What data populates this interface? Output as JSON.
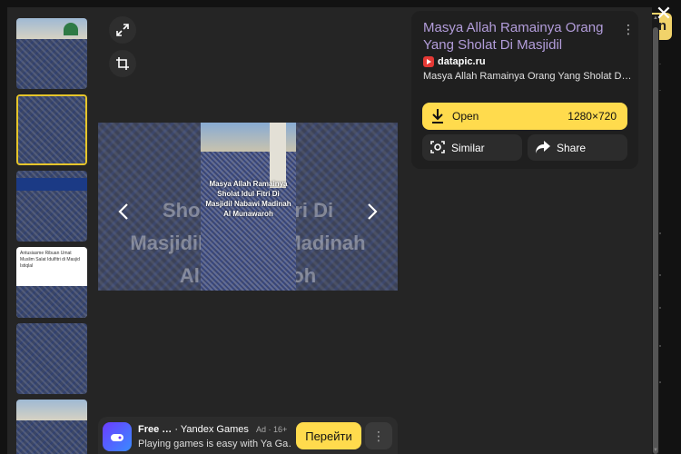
{
  "background_page": {
    "tab_label": "n"
  },
  "viewer": {
    "close_label": "✕",
    "thumbnails": [
      {
        "kind": "mosque",
        "caption": ""
      },
      {
        "kind": "crowd-caption",
        "caption": ""
      },
      {
        "kind": "banner",
        "caption": ""
      },
      {
        "kind": "document",
        "caption": "Antusiasme Ribuan Umat Muslim Salat Idulfitri di Masjid Istiqlal"
      },
      {
        "kind": "crowd",
        "caption": ""
      },
      {
        "kind": "mosque-2",
        "caption": ""
      }
    ],
    "tools": {
      "expand_icon": "expand-icon",
      "crop_icon": "crop-icon"
    },
    "image": {
      "caption": "Masya Allah Ramainya Sholat Idul Fitri Di Masjidil Nabawi Madinah Al Munawaroh",
      "blur_left": "Sholat Idul Fitri Di",
      "blur_mid": "Masjidil Nabawi Madinah",
      "blur_bottom": "Al Munawaroh",
      "prev_label": "‹",
      "next_label": "›"
    },
    "ad": {
      "title": "Free …",
      "advertiser": "· Yandex Games",
      "meta": "Ad · 16+",
      "description": "Playing games is easy with Ya Ga…",
      "cta": "Перейти",
      "more": "⋮"
    }
  },
  "info": {
    "title": "Masya Allah Ramainya Orang Yang Sholat Di Masjidil Nabawi…",
    "more": "⋮",
    "source": "datapic.ru",
    "description": "Masya Allah Ramainya Orang Yang Sholat D…",
    "open_label": "Open",
    "resolution": "1280×720",
    "similar_label": "Similar",
    "share_label": "Share"
  },
  "colors": {
    "accent": "#ffdb4d",
    "title_link": "#b39ddb",
    "panel": "#1f1f1f"
  }
}
